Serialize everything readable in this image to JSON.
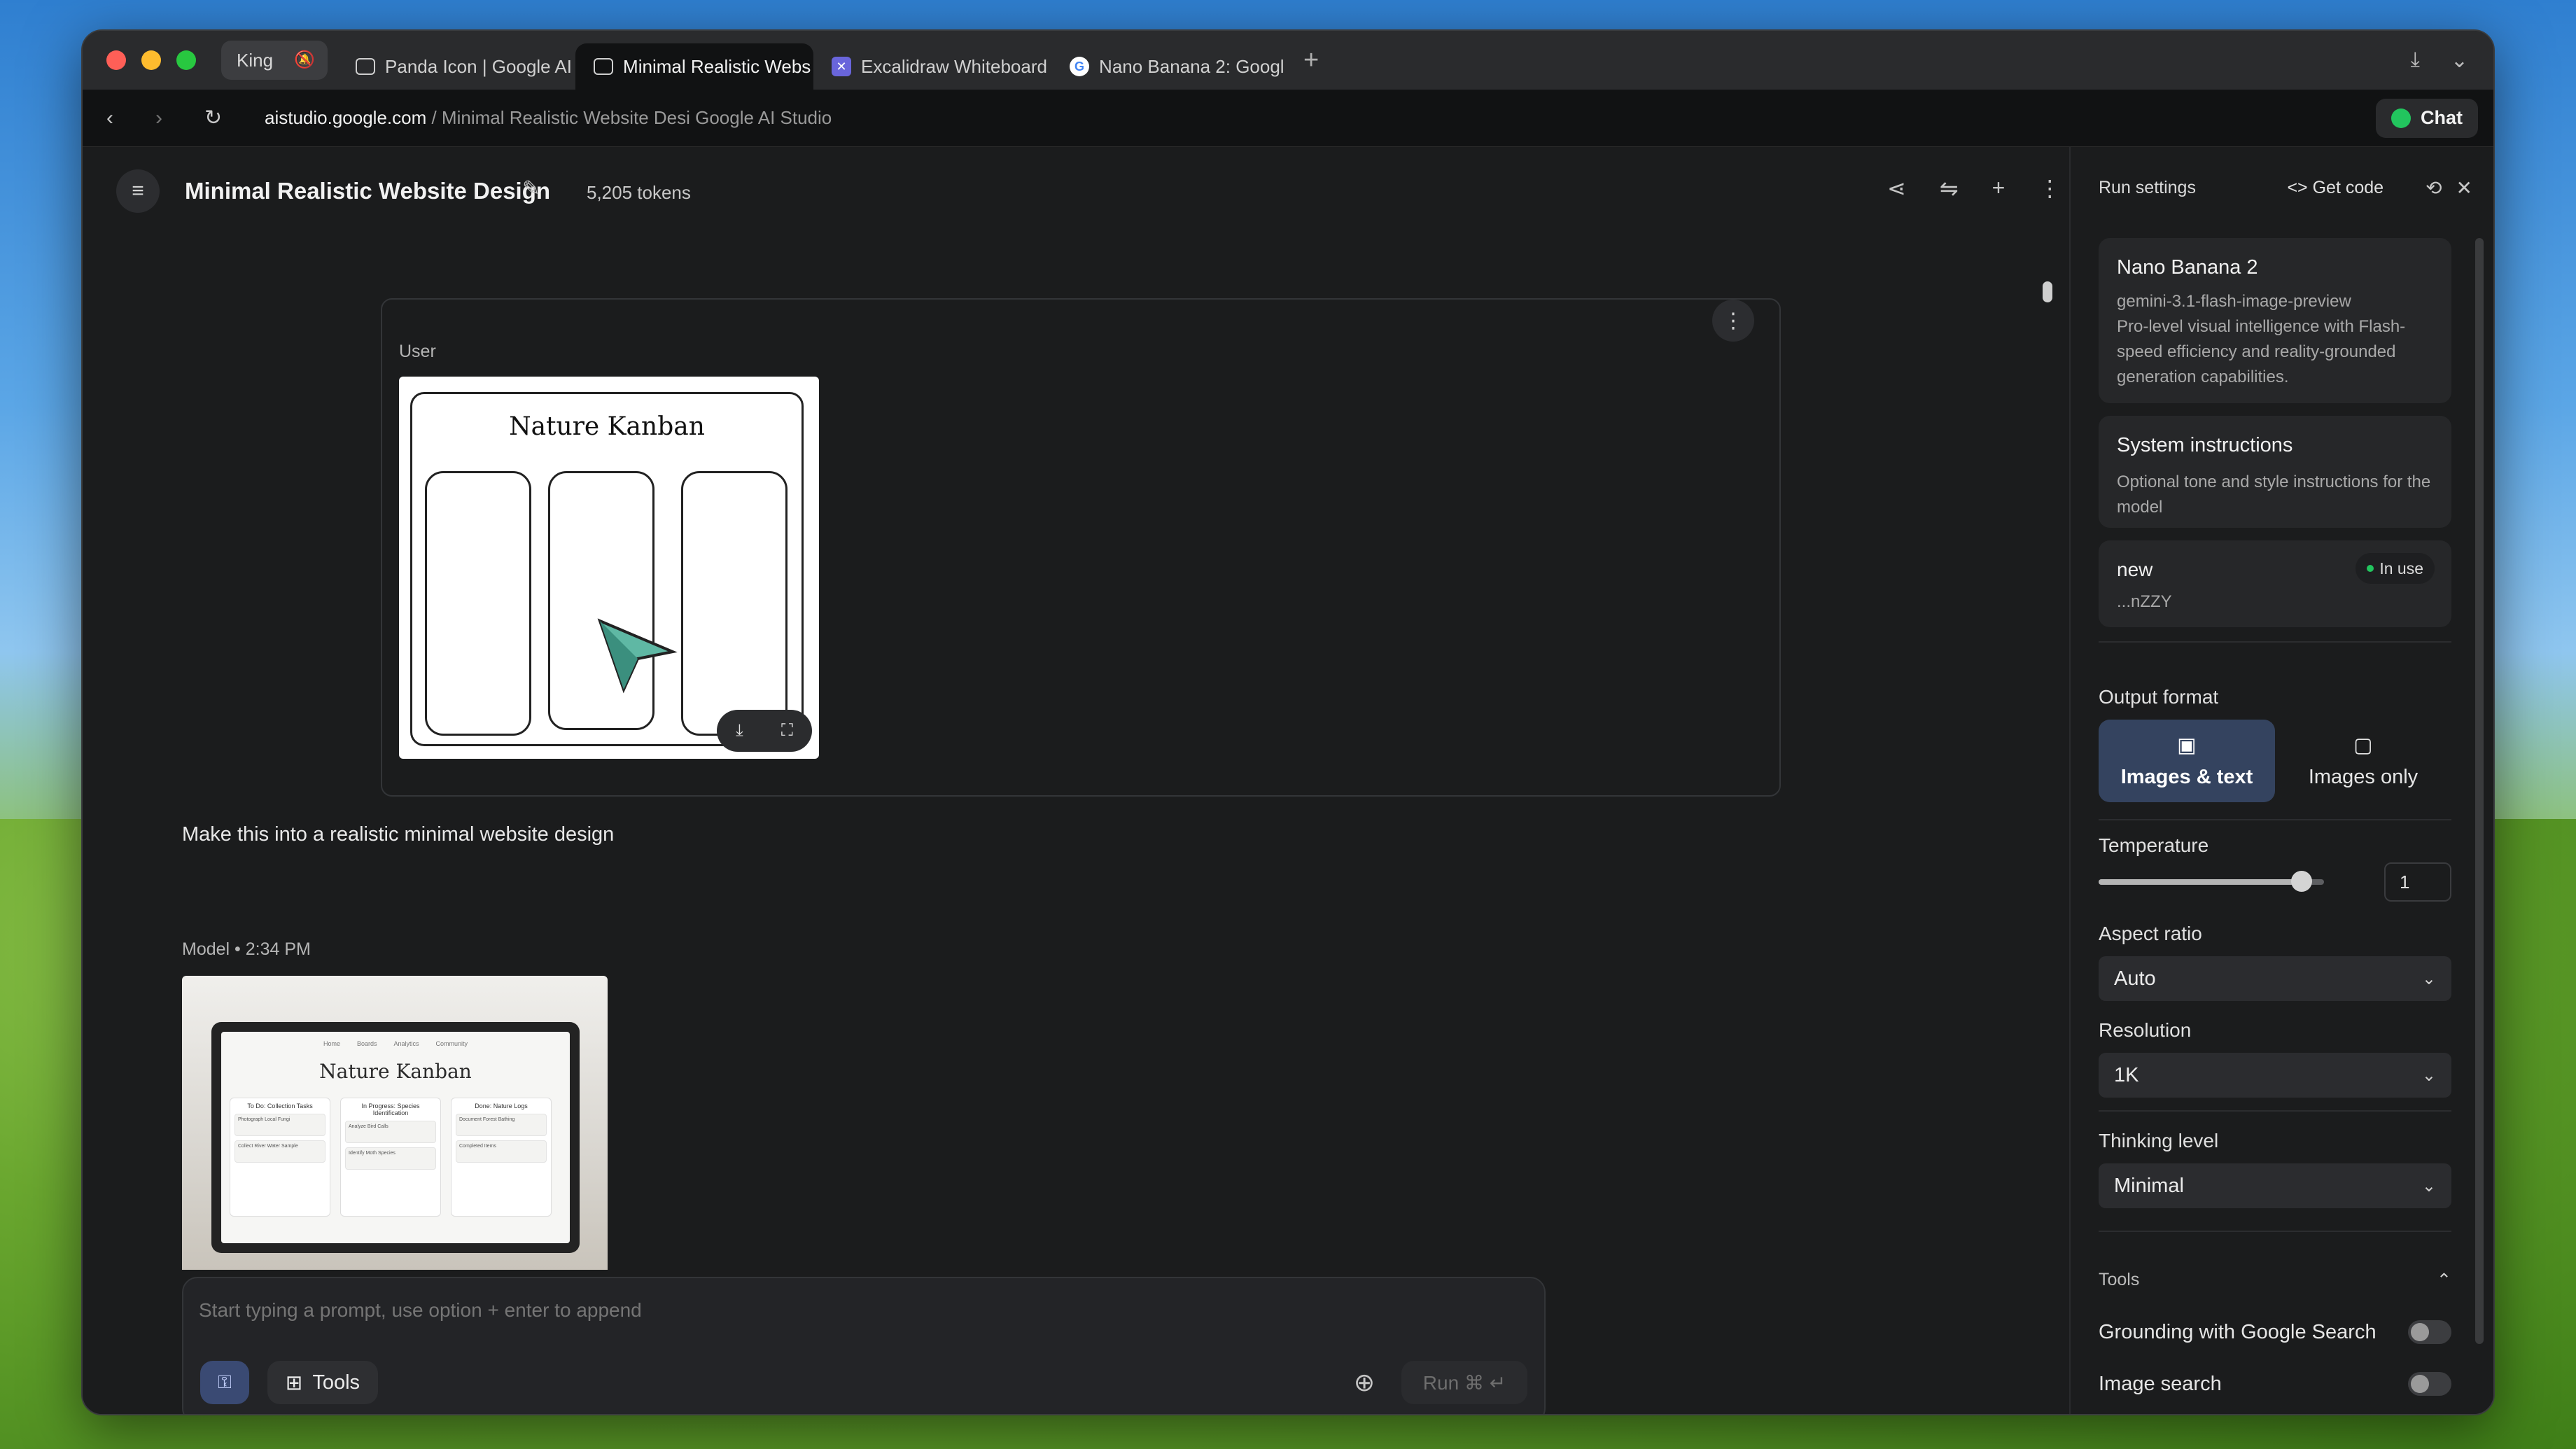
{
  "browser": {
    "tabs": [
      {
        "label": "King"
      },
      {
        "label": "Panda Icon | Google AI"
      },
      {
        "label": "Minimal Realistic Webs"
      },
      {
        "label": "Excalidraw Whiteboard"
      },
      {
        "label": "Nano Banana 2: Googl"
      }
    ],
    "url_host": "aistudio.google.com",
    "url_path": " / Minimal Realistic Website Desi Google AI Studio",
    "chat_label": "Chat"
  },
  "header": {
    "title": "Minimal Realistic Website Design",
    "tokens": "5,205 tokens"
  },
  "conversation": {
    "user_role": "User",
    "sketch_title": "Nature Kanban",
    "prompt": "Make this into a realistic minimal website design",
    "model_role": "Model",
    "model_time": "2:34 PM",
    "render": {
      "nav": [
        "Home",
        "Boards",
        "Analytics",
        "Community"
      ],
      "title": "Nature Kanban",
      "columns": [
        {
          "heading": "To Do: Collection Tasks",
          "cards": [
            "Photograph Local Fungi",
            "Collect River Water Sample"
          ]
        },
        {
          "heading": "In Progress: Species Identification",
          "cards": [
            "Analyze Bird Calls",
            "Identify Moth Species"
          ]
        },
        {
          "heading": "Done: Nature Logs",
          "cards": [
            "Document Forest Bathing",
            "Completed Items"
          ]
        }
      ]
    }
  },
  "composer": {
    "placeholder": "Start typing a prompt, use option + enter to append",
    "tools_label": "Tools",
    "run_label": "Run ⌘ ↵"
  },
  "run_settings": {
    "title": "Run settings",
    "get_code": "Get code",
    "model": {
      "name": "Nano Banana 2",
      "id": "gemini-3.1-flash-image-preview",
      "description": "Pro-level visual intelligence with Flash-speed efficiency and reality-grounded generation capabilities."
    },
    "system_instructions": {
      "title": "System instructions",
      "description": "Optional tone and style instructions for the model"
    },
    "api_key": {
      "name": "new",
      "status": "In use",
      "suffix": "...nZZY"
    },
    "output_format": {
      "label": "Output format",
      "options": [
        "Images & text",
        "Images only"
      ],
      "selected": "Images & text"
    },
    "temperature": {
      "label": "Temperature",
      "value": "1",
      "fraction": 0.9
    },
    "aspect_ratio": {
      "label": "Aspect ratio",
      "value": "Auto"
    },
    "resolution": {
      "label": "Resolution",
      "value": "1K"
    },
    "thinking_level": {
      "label": "Thinking level",
      "value": "Minimal"
    },
    "tools": {
      "label": "Tools",
      "grounding": "Grounding with Google Search",
      "image_search": "Image search"
    }
  }
}
